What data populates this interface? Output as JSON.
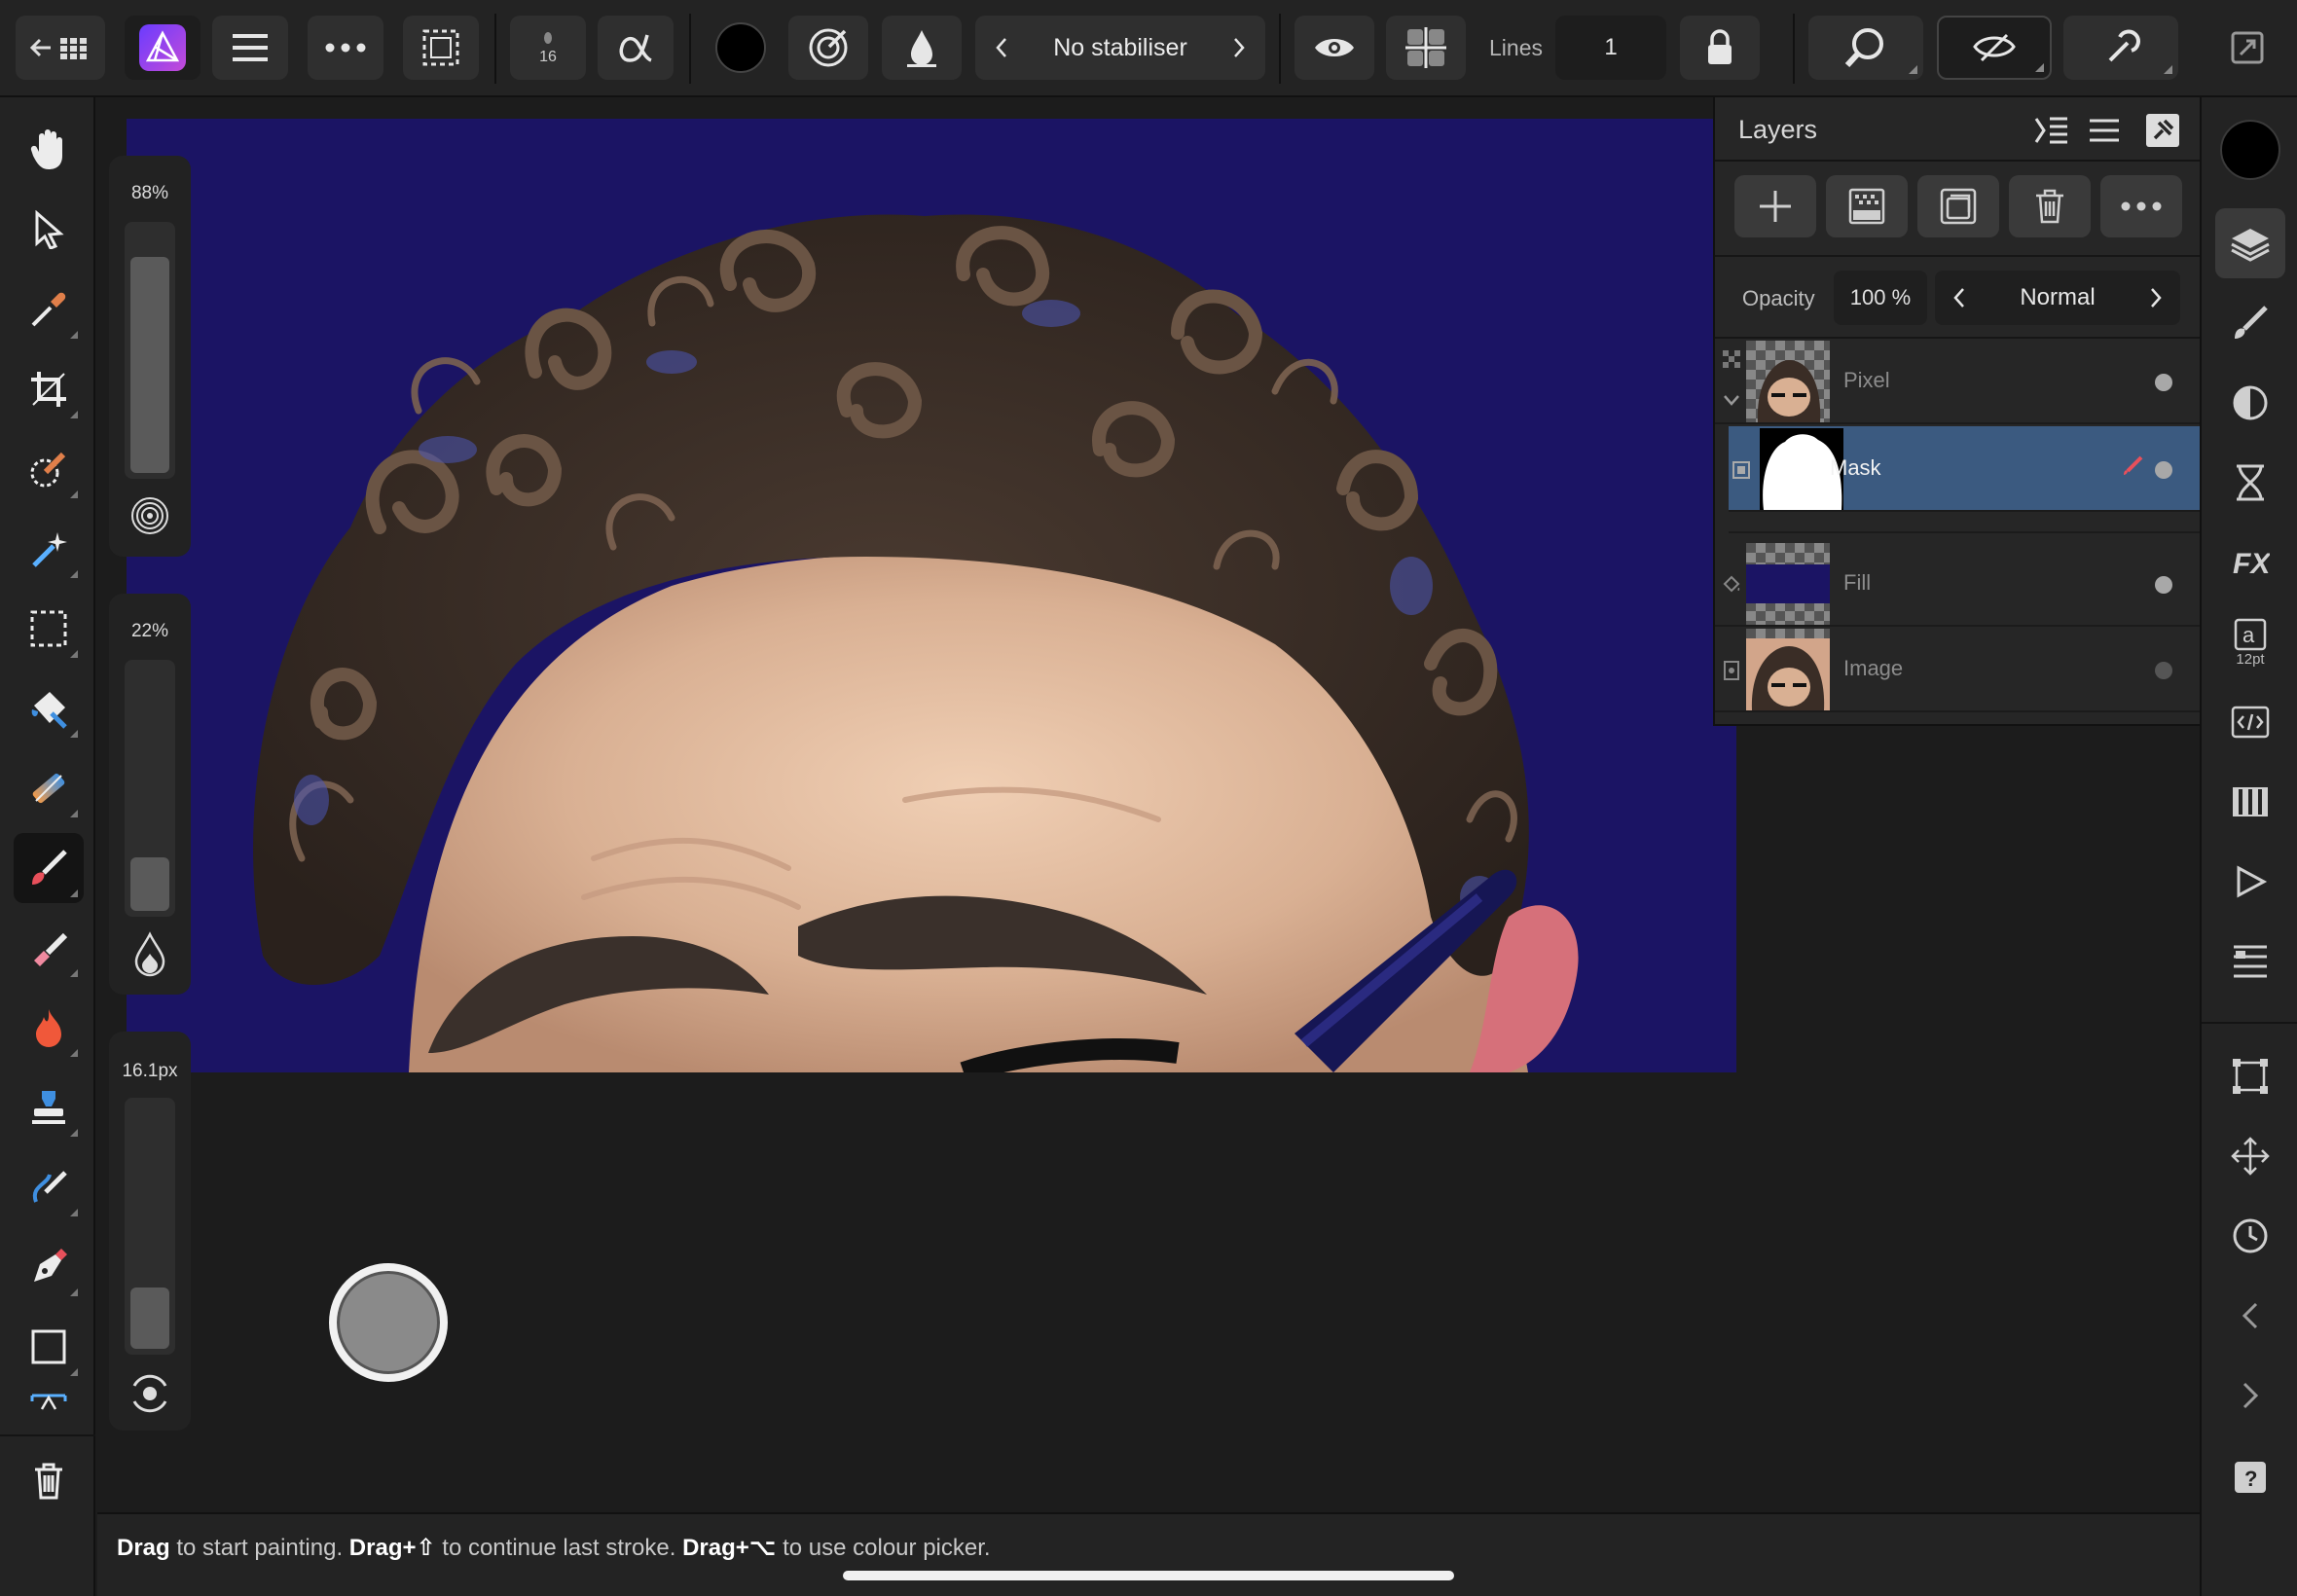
{
  "toolbar": {
    "brush_size_value": "16",
    "stabiliser_label": "No stabiliser",
    "lines_label": "Lines",
    "lines_value": "1"
  },
  "sliders": {
    "opacity_value": "88%",
    "opacity_level": 0.88,
    "flow_value": "22%",
    "flow_level": 0.22,
    "width_value": "16.1px",
    "width_level": 0.25
  },
  "layers_panel": {
    "title": "Layers",
    "opacity_label": "Opacity",
    "opacity_value": "100 %",
    "blend_mode": "Normal",
    "layers": [
      {
        "name": "Pixel",
        "selected": false,
        "visible": true
      },
      {
        "name": "Mask",
        "selected": true,
        "visible": true
      },
      {
        "name": "Fill",
        "selected": false,
        "visible": true
      },
      {
        "name": "Image",
        "selected": false,
        "visible": false
      }
    ]
  },
  "right_studio": {
    "text_size_label": "12pt"
  },
  "status": {
    "hint_part1": "Drag",
    "hint_part2": " to start painting. ",
    "hint_part3": "Drag+⇧",
    "hint_part4": " to continue last stroke. ",
    "hint_part5": "Drag+⌥",
    "hint_part6": " to use colour picker."
  },
  "colors": {
    "canvas_background": "#1b1464",
    "selected_layer": "#3b5a80",
    "primary_color": "#000000"
  }
}
